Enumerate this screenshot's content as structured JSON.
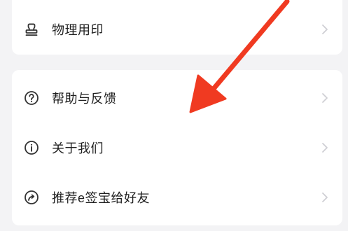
{
  "menu_top": {
    "items": [
      {
        "label": "物理用印",
        "icon": "stamp-icon"
      }
    ]
  },
  "menu_main": {
    "items": [
      {
        "label": "帮助与反馈",
        "icon": "help-circle-icon"
      },
      {
        "label": "关于我们",
        "icon": "info-circle-icon"
      },
      {
        "label": "推荐e签宝给好友",
        "icon": "share-circle-icon"
      }
    ]
  },
  "colors": {
    "background": "#f3f3f5",
    "card": "#ffffff",
    "text": "#1f1f1f",
    "chevron": "#cfcfd4",
    "annotation_arrow": "#f03a21"
  }
}
